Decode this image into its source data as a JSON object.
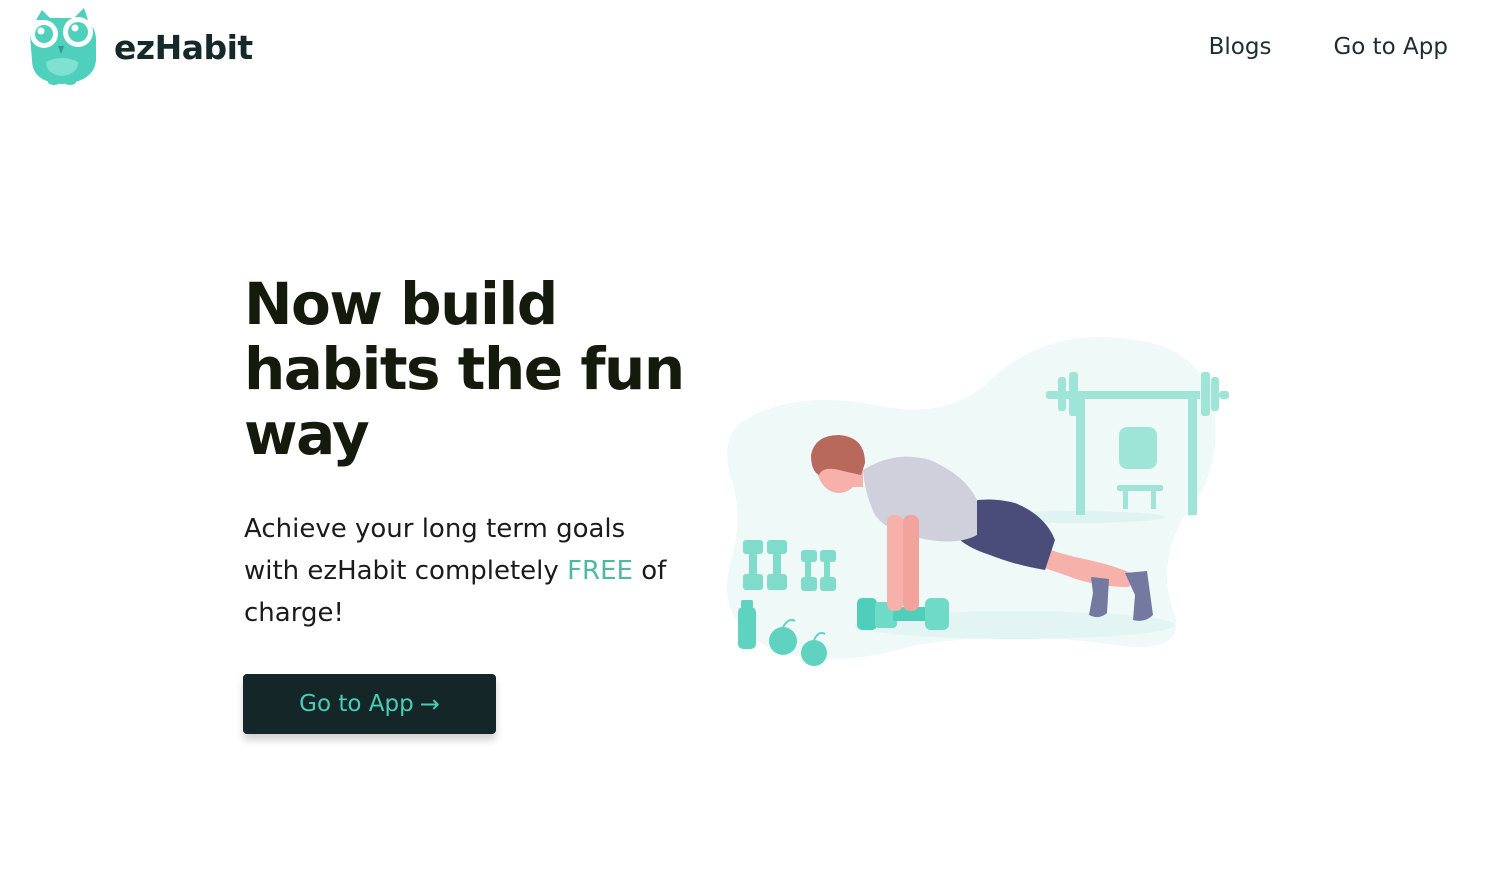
{
  "header": {
    "brand": "ezHabit",
    "nav": [
      {
        "label": "Blogs"
      },
      {
        "label": "Go to App"
      }
    ]
  },
  "hero": {
    "title": "Now build habits the fun way",
    "subtitle_before": "Achieve your long term goals with ezHabit completely ",
    "subtitle_highlight": "FREE",
    "subtitle_after": " of charge!",
    "cta_label": "Go to App",
    "cta_icon": "→"
  },
  "colors": {
    "accent": "#4fcfbb",
    "dark": "#142628",
    "text": "#141a0c"
  }
}
